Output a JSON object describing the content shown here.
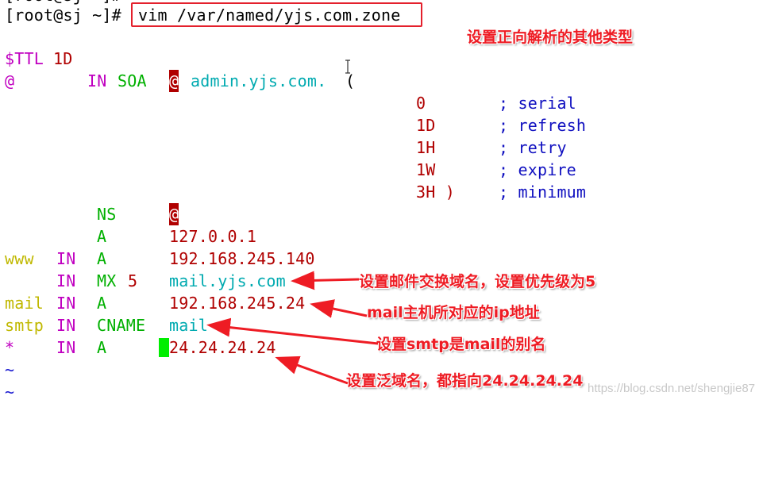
{
  "terminal": {
    "prompt": "[root@sj ~]#",
    "command": "vim /var/named/yjs.com.zone",
    "zone": {
      "ttl_directive": "$TTL",
      "ttl_value": "1D",
      "soa": {
        "origin": "@",
        "class": "IN",
        "type": "SOA",
        "primary_ns": "@",
        "admin": "admin.yjs.com.",
        "open_paren": "("
      },
      "soa_fields": [
        {
          "value": "0",
          "comment": "; serial"
        },
        {
          "value": "1D",
          "comment": "; refresh"
        },
        {
          "value": "1H",
          "comment": "; retry"
        },
        {
          "value": "1W",
          "comment": "; expire"
        },
        {
          "value": "3H )",
          "comment": "; minimum"
        }
      ],
      "records": [
        {
          "name": "",
          "class": "",
          "type": "NS",
          "priority": "",
          "rdata": "@"
        },
        {
          "name": "",
          "class": "",
          "type": "A",
          "priority": "",
          "rdata": "127.0.0.1"
        },
        {
          "name": "www",
          "class": "IN",
          "type": "A",
          "priority": "",
          "rdata": "192.168.245.140"
        },
        {
          "name": "",
          "class": "IN",
          "type": "MX",
          "priority": "5",
          "rdata": "mail.yjs.com"
        },
        {
          "name": "mail",
          "class": "IN",
          "type": "A",
          "priority": "",
          "rdata": "192.168.245.24"
        },
        {
          "name": "smtp",
          "class": "IN",
          "type": "CNAME",
          "priority": "",
          "rdata": "mail"
        },
        {
          "name": "*",
          "class": "IN",
          "type": "A",
          "priority": "",
          "rdata": "24.24.24.24"
        }
      ],
      "tildes": [
        "~",
        "~"
      ]
    }
  },
  "annotations": {
    "title": "设置正向解析的其他类型",
    "mx_note": "设置邮件交换域名，设置优先级为5",
    "mail_a_note": "mail主机所对应的ip地址",
    "cname_note": "设置smtp是mail的别名",
    "wildcard_note": "设置泛域名，都指向24.24.24.24"
  },
  "watermark": "https://blog.csdn.net/shengjie87",
  "colors": {
    "annotation": "#ee1c24",
    "highlight_box": "#e4202c",
    "cursor": "#00ee00"
  }
}
